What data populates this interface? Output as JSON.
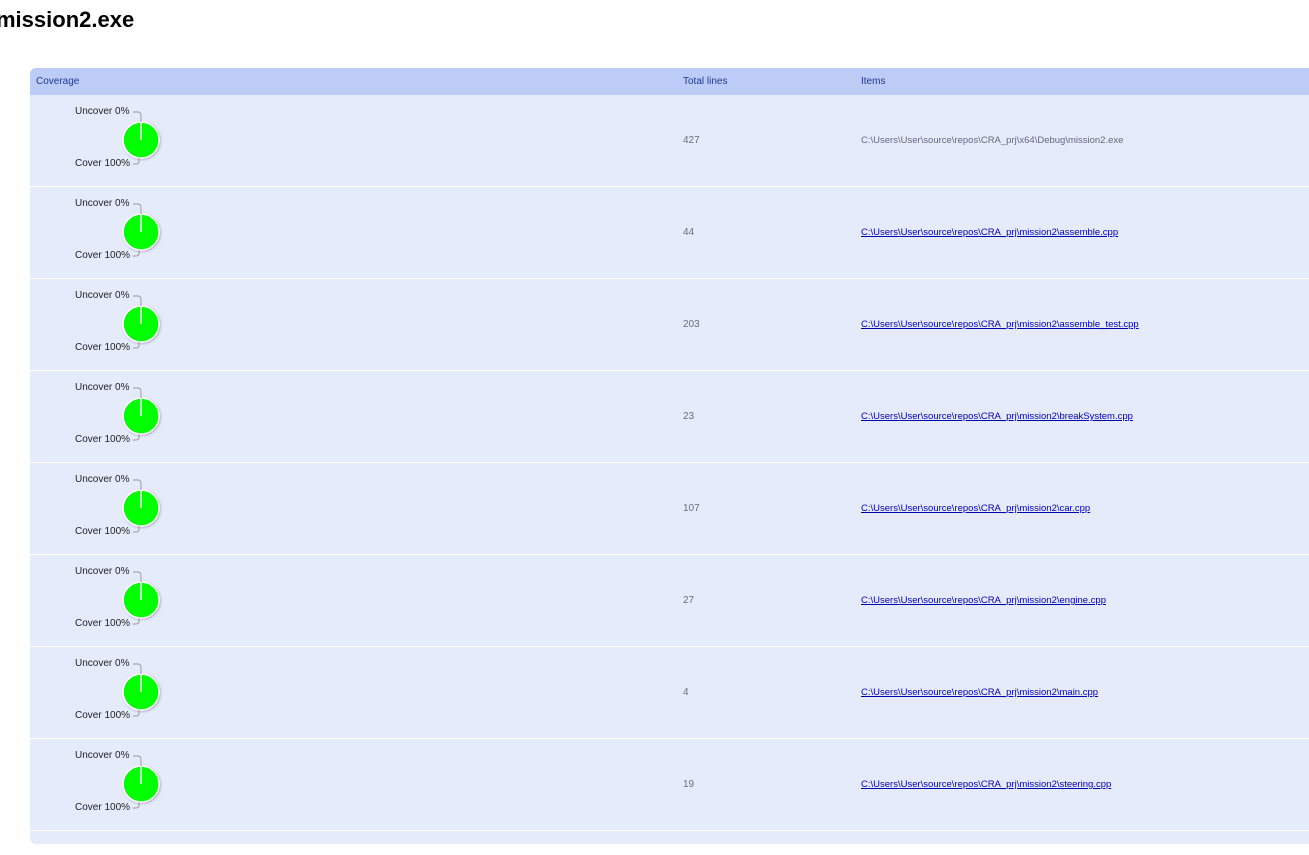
{
  "page": {
    "title": "mission2.exe"
  },
  "table": {
    "headers": {
      "coverage": "Coverage",
      "total_lines": "Total lines",
      "items": "Items"
    },
    "rows": [
      {
        "uncover_label": "Uncover 0%",
        "cover_label": "Cover 100%",
        "cover_pct": 100,
        "total_lines": "427",
        "item": "C:\\Users\\User\\source\\repos\\CRA_prj\\x64\\Debug\\mission2.exe",
        "is_link": false
      },
      {
        "uncover_label": "Uncover 0%",
        "cover_label": "Cover 100%",
        "cover_pct": 100,
        "total_lines": "44",
        "item": "C:\\Users\\User\\source\\repos\\CRA_prj\\mission2\\assemble.cpp",
        "is_link": true
      },
      {
        "uncover_label": "Uncover 0%",
        "cover_label": "Cover 100%",
        "cover_pct": 100,
        "total_lines": "203",
        "item": "C:\\Users\\User\\source\\repos\\CRA_prj\\mission2\\assemble_test.cpp",
        "is_link": true
      },
      {
        "uncover_label": "Uncover 0%",
        "cover_label": "Cover 100%",
        "cover_pct": 100,
        "total_lines": "23",
        "item": "C:\\Users\\User\\source\\repos\\CRA_prj\\mission2\\breakSystem.cpp",
        "is_link": true
      },
      {
        "uncover_label": "Uncover 0%",
        "cover_label": "Cover 100%",
        "cover_pct": 100,
        "total_lines": "107",
        "item": "C:\\Users\\User\\source\\repos\\CRA_prj\\mission2\\car.cpp",
        "is_link": true
      },
      {
        "uncover_label": "Uncover 0%",
        "cover_label": "Cover 100%",
        "cover_pct": 100,
        "total_lines": "27",
        "item": "C:\\Users\\User\\source\\repos\\CRA_prj\\mission2\\engine.cpp",
        "is_link": true
      },
      {
        "uncover_label": "Uncover 0%",
        "cover_label": "Cover 100%",
        "cover_pct": 100,
        "total_lines": "4",
        "item": "C:\\Users\\User\\source\\repos\\CRA_prj\\mission2\\main.cpp",
        "is_link": true
      },
      {
        "uncover_label": "Uncover 0%",
        "cover_label": "Cover 100%",
        "cover_pct": 100,
        "total_lines": "19",
        "item": "C:\\Users\\User\\source\\repos\\CRA_prj\\mission2\\steering.cpp",
        "is_link": true
      }
    ]
  },
  "colors": {
    "cover": "#00ff00",
    "header_bg": "#bdcbf7",
    "row_bg": "#e6ebfb",
    "link": "#0000b0"
  },
  "icons": {
    "coverage_chart": "pie-chart-icon"
  }
}
